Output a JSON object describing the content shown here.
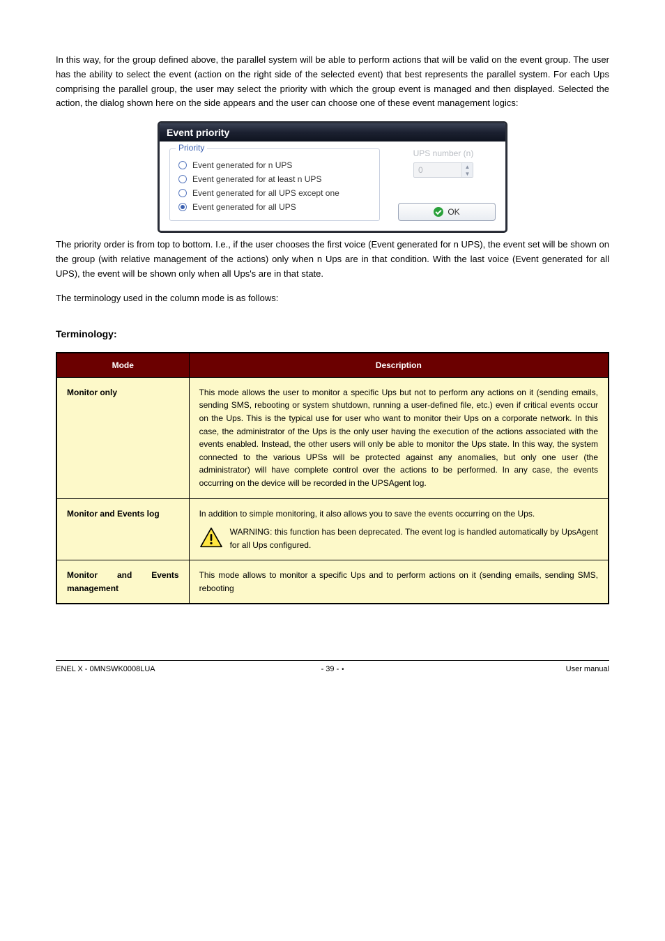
{
  "intro": {
    "p1": "In this way, for the group defined above, the parallel system will be able to perform actions that will be valid on the event group. The user has the ability to select the event (action on the right side of the selected event) that best represents the parallel system. For each Ups comprising the parallel group, the user may select the priority with which the group event is managed and then displayed. Selected the action, the dialog shown here on the side appears and the user can choose one of these event management logics:"
  },
  "dialog": {
    "title": "Event priority",
    "legend": "Priority",
    "options": [
      "Event generated for n UPS",
      "Event generated for at least n UPS",
      "Event generated for all UPS except one",
      "Event generated for all UPS"
    ],
    "selected_index": 3,
    "ups_number_label": "UPS number (n)",
    "ups_number_value": "0",
    "ok_label": "OK"
  },
  "post": {
    "p1": "The priority order is from top to bottom. I.e., if the user chooses the first voice (Event generated for n UPS), the event set will be shown on the group (with relative management of the actions) only when n Ups are in that condition. With the last voice (Event generated for all UPS), the event will be shown only when all Ups's are in that state.",
    "p2": "The terminology used in the column mode is as follows:",
    "terminology_label": "Terminology:"
  },
  "table": {
    "headers": [
      "Mode",
      "Description"
    ],
    "rows": [
      {
        "mode": "Monitor only",
        "desc": "This mode allows the user to monitor a specific Ups but not to perform any actions on it (sending emails, sending SMS, rebooting or system shutdown, running a user-defined file, etc.) even if critical events occur on the Ups. This is the typical use for user who want to monitor their Ups on a corporate network. In this case, the administrator of the Ups is the only user having the execution of the actions associated with the events enabled. Instead, the other users will only be able to monitor the Ups state. In this way, the system connected to the various UPSs will be protected against any anomalies, but only one user (the administrator) will have complete control over the actions to be performed. In any case, the events occurring on the device will be recorded in the UPSAgent log."
      },
      {
        "mode": "Monitor and Events log",
        "desc_plain": "In addition to simple monitoring, it also allows you to save the events occurring on the Ups.",
        "warn": "WARNING: this function has been deprecated. The event log is handled automatically by UpsAgent for all Ups configured."
      },
      {
        "mode": "Monitor and Events management",
        "desc": "This mode allows to monitor a specific Ups and to perform actions on it (sending emails, sending SMS, rebooting"
      }
    ]
  },
  "footer": {
    "left": "ENEL X - 0MNSWK0008LUA",
    "center_page": "- 39 -",
    "right": "User manual"
  }
}
